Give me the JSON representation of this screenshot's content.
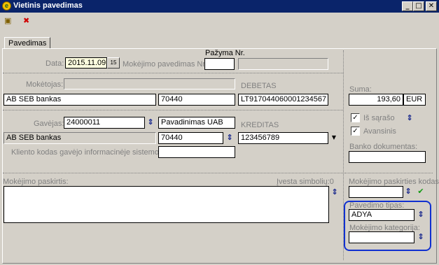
{
  "window": {
    "title": "Vietinis pavedimas",
    "minimize": "_",
    "maximize": "□",
    "close": "✕"
  },
  "toolbar": {
    "save_glyph": "▣",
    "cancel_glyph": "✖"
  },
  "tabs": [
    {
      "label": "Pavedimas"
    }
  ],
  "header": {
    "date_label": "Data:",
    "date_value": "2015.11.09",
    "calendar_glyph": "15",
    "order_no_label": "Mokėjimo pavedimas Nr.",
    "order_no_value": "",
    "certificate_label": "Pažyma Nr.",
    "certificate_value": ""
  },
  "payer": {
    "label": "Mokėtojas:",
    "value": "",
    "bank": "AB SEB bankas",
    "bank_code": "70440",
    "debit_label": "DEBETAS",
    "debit_account": "LT917044060001234567"
  },
  "sum": {
    "label": "Suma:",
    "value": "193,60",
    "currency": "EUR"
  },
  "payee": {
    "label": "Gavėjas:",
    "code": "24000011",
    "name": "Pavadinimas UAB",
    "bank": "AB SEB bankas",
    "bank_code": "70440",
    "credit_label": "KREDITAS",
    "credit_account": "123456789",
    "client_code_label": "Kliento kodas gavėjo informacinėje sistemoje:",
    "client_code_value": ""
  },
  "options": {
    "from_list_label": "Iš sąrašo",
    "from_list_checked": true,
    "advance_label": "Avansinis",
    "advance_checked": true,
    "bank_document_label": "Banko dokumentas:",
    "bank_document_value": ""
  },
  "purpose": {
    "label": "Mokėjimo paskirtis:",
    "counter": "Įvesta simbolių:0",
    "value": ""
  },
  "right_panel": {
    "purpose_code_label": "Mokėjimo paskirties kodas:",
    "purpose_code_value": "",
    "order_type_label": "Pavedimo tipas:",
    "order_type_value": "ADYA",
    "category_label": "Mokėjimo kategorija:",
    "category_value": ""
  },
  "icons": {
    "sort_arrow": "⇕",
    "dropdown_arrow": "▼",
    "checkmark": "✔",
    "check": "✓"
  },
  "colors": {
    "title_bar": "#0a246a",
    "highlight": "#1030d0",
    "arrow": "#10208a",
    "ok_check": "#119911"
  }
}
